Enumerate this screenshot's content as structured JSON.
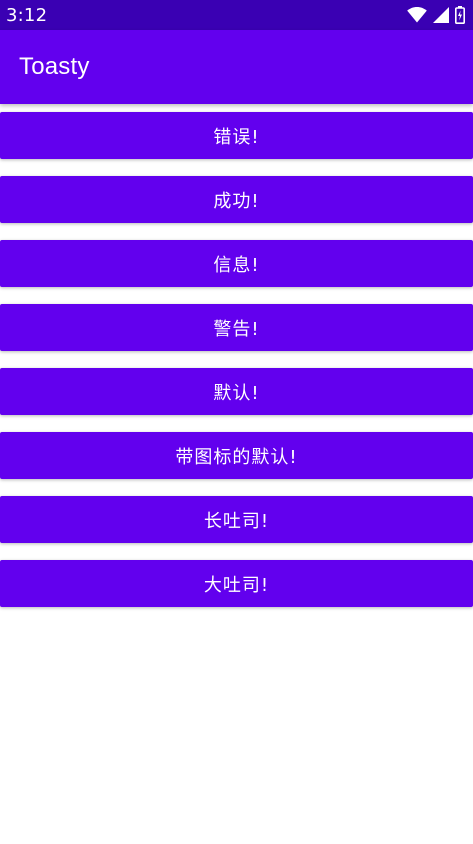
{
  "status_bar": {
    "time": "3:12",
    "icons": [
      "wifi-icon",
      "signal-icon",
      "battery-icon"
    ]
  },
  "app_bar": {
    "title": "Toasty"
  },
  "colors": {
    "status_bar": "#3a00b3",
    "primary": "#6200ee",
    "text_on_primary": "#ffffff",
    "background": "#ffffff"
  },
  "buttons": [
    {
      "label": "错误!"
    },
    {
      "label": "成功!"
    },
    {
      "label": "信息!"
    },
    {
      "label": "警告!"
    },
    {
      "label": "默认!"
    },
    {
      "label": "带图标的默认!"
    },
    {
      "label": "长吐司!"
    },
    {
      "label": "大吐司!"
    }
  ]
}
